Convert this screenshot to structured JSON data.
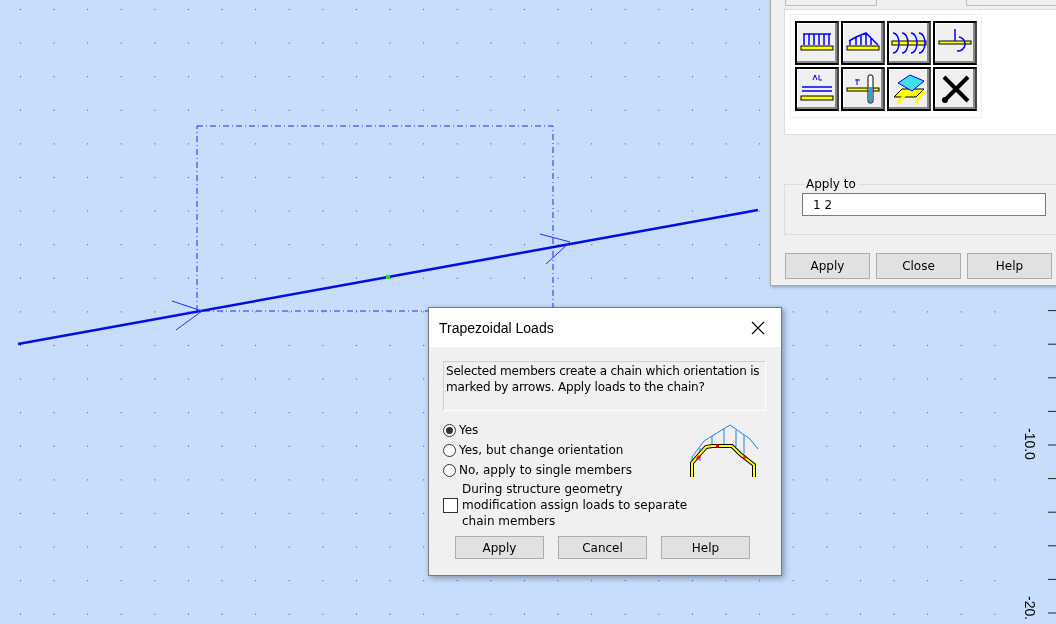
{
  "ruler": {
    "labels": [
      "-10.0",
      "-20."
    ]
  },
  "loads_panel": {
    "apply_to": {
      "label": "Apply to",
      "value": "1 2"
    },
    "buttons": [
      "Apply",
      "Close",
      "Help"
    ]
  },
  "dialog": {
    "title": "Trapezoidal Loads",
    "message": "Selected members create a chain which orientation is marked by arrows. Apply loads to the chain?",
    "options": [
      {
        "label": "Yes",
        "selected": true
      },
      {
        "label": "Yes, but change orientation",
        "selected": false
      },
      {
        "label": "No, apply to single members",
        "selected": false
      }
    ],
    "checkbox": {
      "label": "During structure geometry modification assign loads to separate chain members",
      "checked": false
    },
    "buttons": [
      "Apply",
      "Cancel",
      "Help"
    ]
  }
}
